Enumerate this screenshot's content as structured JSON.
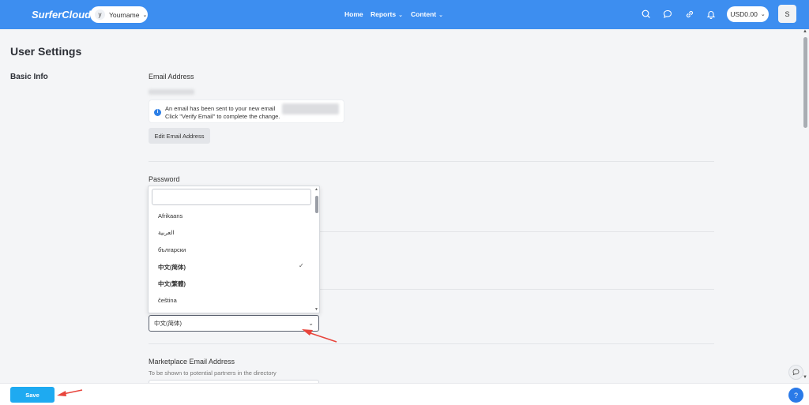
{
  "header": {
    "logo": "SurferCloud",
    "workspace": {
      "initial": "y",
      "name": "Yourname"
    },
    "nav": [
      "Home",
      "Reports",
      "Content"
    ],
    "icons": [
      "search-icon",
      "chat-bubble-icon",
      "link-icon",
      "bell-icon"
    ],
    "currency": "USD0.00",
    "user_initial": "S"
  },
  "page": {
    "title": "User Settings",
    "section": "Basic Info"
  },
  "email": {
    "label": "Email Address",
    "notice_line1": "An email has been sent to your new email",
    "notice_line2": "Click \"Verify Email\" to complete the change.",
    "edit_button": "Edit Email Address"
  },
  "password": {
    "label": "Password"
  },
  "language": {
    "search_value": "",
    "options": [
      "Afrikaans",
      "العربية",
      "български",
      "中文(简体)",
      "中文(繁體)",
      "čeština"
    ],
    "selected": "中文(简体)",
    "selected_value": "中文(简体)"
  },
  "marketplace": {
    "label": "Marketplace Email Address",
    "hint": "To be shown to potential partners in the directory"
  },
  "footer": {
    "save_label": "Save",
    "help_label": "?"
  },
  "colors": {
    "topbar": "#3d8ef0",
    "save": "#1eaaf1",
    "annotation_arrow": "#e8453c"
  }
}
